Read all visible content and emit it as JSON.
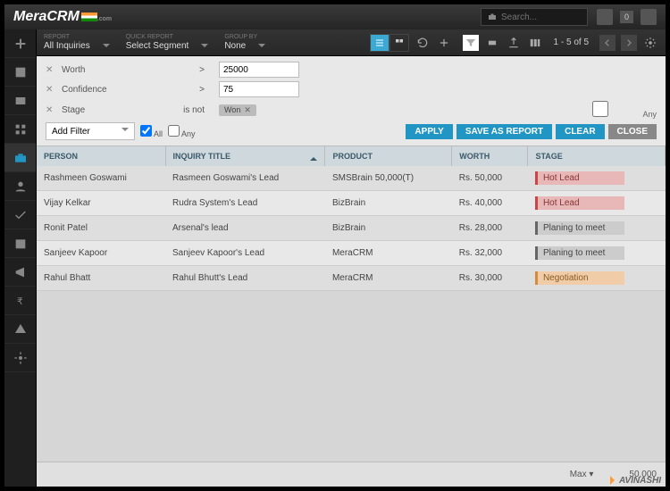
{
  "header": {
    "logo": "MeraCRM",
    "logo_sub": ".com",
    "search_placeholder": "Search...",
    "notif_count": "0"
  },
  "toolbar": {
    "report_lbl": "REPORT",
    "report_val": "All Inquiries",
    "quick_lbl": "QUICK REPORT",
    "quick_val": "Select Segment",
    "group_lbl": "GROUP BY",
    "group_val": "None",
    "pager": "1 - 5 of 5"
  },
  "filters": {
    "rows": [
      {
        "field": "Worth",
        "op": ">",
        "value": "25000"
      },
      {
        "field": "Confidence",
        "op": ">",
        "value": "75"
      },
      {
        "field": "Stage",
        "op": "is not",
        "value": "Won"
      }
    ],
    "any_label": "Any",
    "add_filter": "Add Filter",
    "all": "All",
    "any": "Any",
    "apply": "APPLY",
    "save": "SAVE AS REPORT",
    "clear": "CLEAR",
    "close": "CLOSE"
  },
  "columns": [
    "PERSON",
    "INQUIRY TITLE",
    "PRODUCT",
    "WORTH",
    "STAGE"
  ],
  "rows": [
    {
      "person": "Rashmeen Goswami",
      "title": "Rasmeen Goswami's Lead",
      "product": "SMSBrain 50,000(T)",
      "worth": "Rs. 50,000",
      "stage": "Hot Lead",
      "stage_cls": "hot"
    },
    {
      "person": "Vijay Kelkar",
      "title": "Rudra System's Lead",
      "product": "BizBrain",
      "worth": "Rs. 40,000",
      "stage": "Hot Lead",
      "stage_cls": "hot"
    },
    {
      "person": "Ronit Patel",
      "title": "Arsenal's lead",
      "product": "BizBrain",
      "worth": "Rs. 28,000",
      "stage": "Planing to meet",
      "stage_cls": "plan"
    },
    {
      "person": "Sanjeev Kapoor",
      "title": "Sanjeev Kapoor's Lead",
      "product": "MeraCRM",
      "worth": "Rs. 32,000",
      "stage": "Planing to meet",
      "stage_cls": "plan"
    },
    {
      "person": "Rahul Bhatt",
      "title": "Rahul Bhutt's Lead",
      "product": "MeraCRM",
      "worth": "Rs. 30,000",
      "stage": "Negotiation",
      "stage_cls": "neg"
    }
  ],
  "footer": {
    "max_lbl": "Max",
    "max_val": "50,000"
  },
  "brand_footer": "AVINASHI"
}
